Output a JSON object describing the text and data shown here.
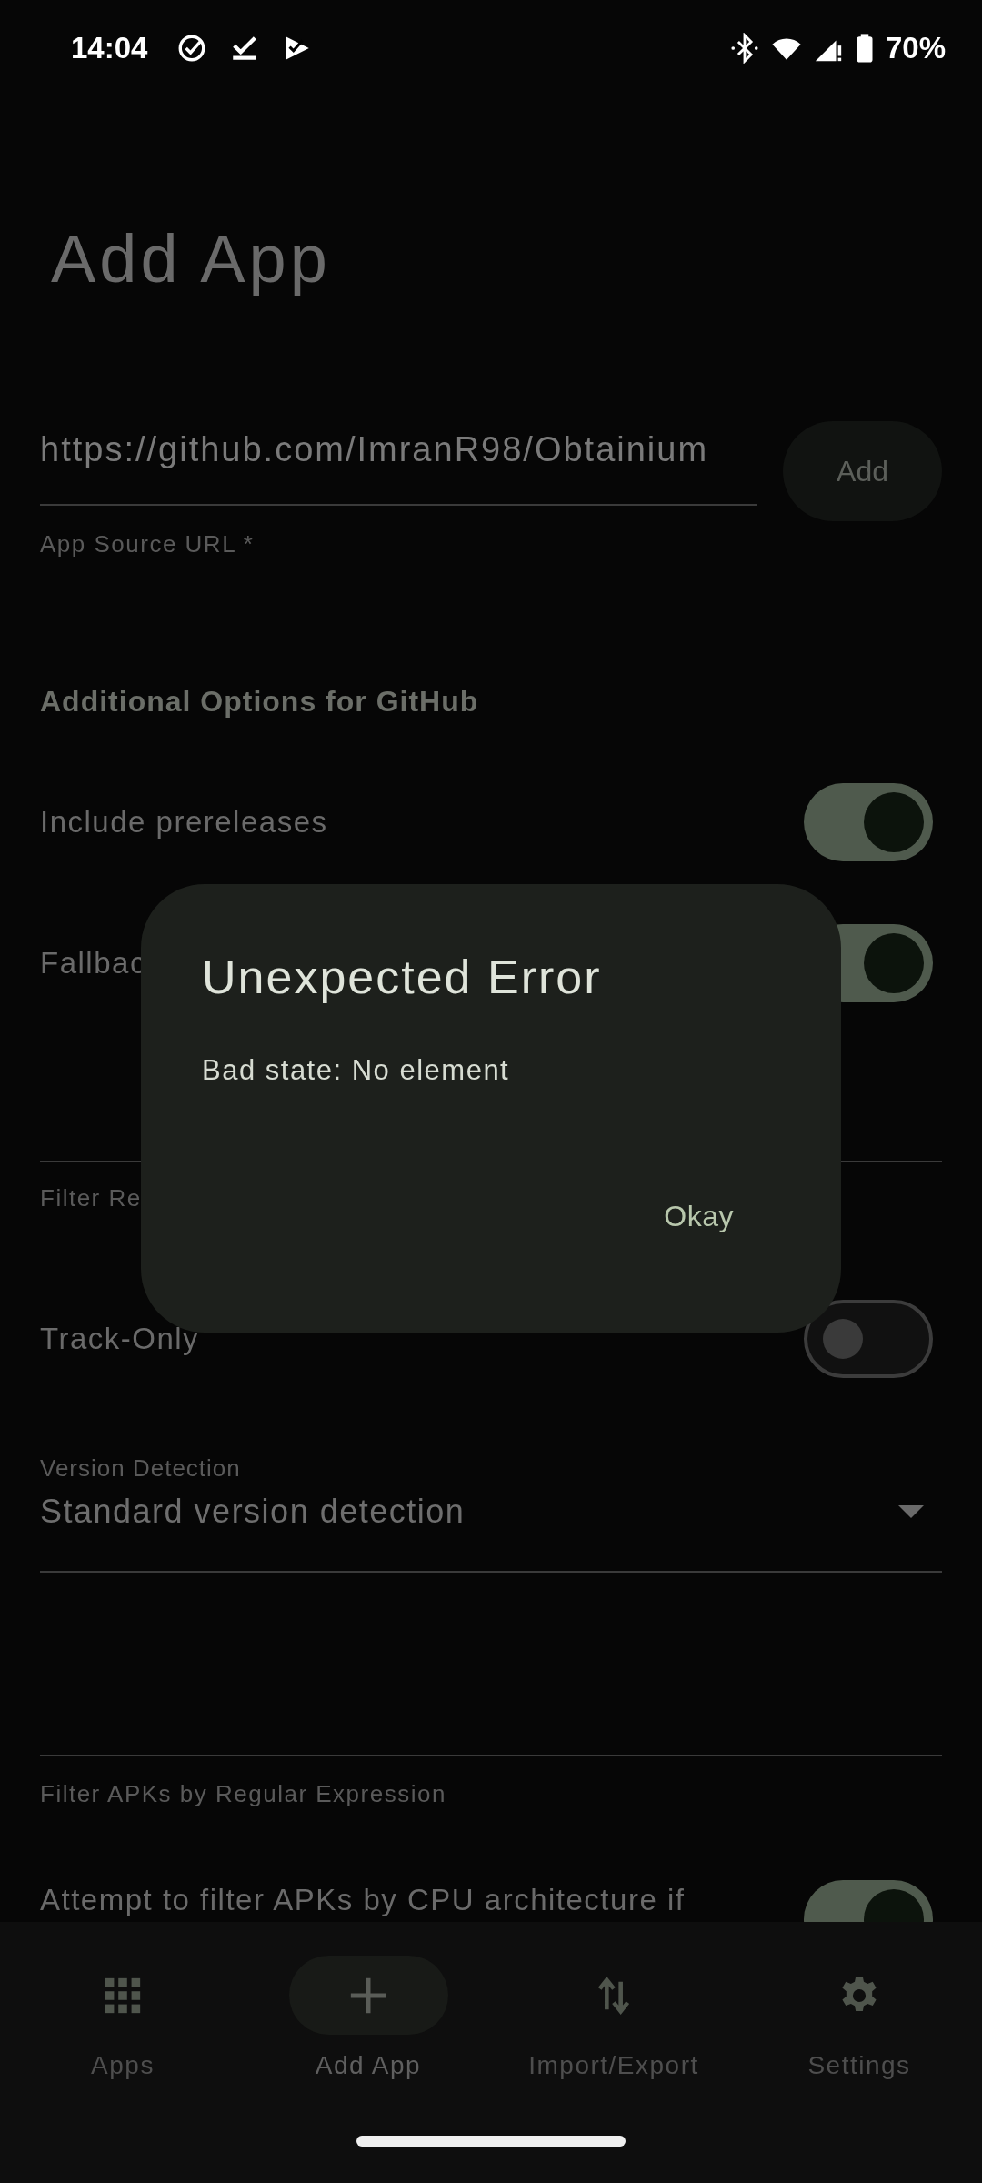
{
  "status_bar": {
    "time": "14:04",
    "battery": "70%"
  },
  "title": "Add App",
  "url_field": {
    "value": "https://github.com/ImranR98/Obtainium",
    "label": "App Source URL *"
  },
  "add_button": {
    "label": "Add"
  },
  "section_title": "Additional Options for GitHub",
  "options": [
    {
      "kind": "toggle",
      "label": "Include prereleases",
      "on": true
    },
    {
      "kind": "toggle",
      "label": "Fallbac",
      "on": true
    },
    {
      "kind": "field",
      "label": "Filter Re"
    },
    {
      "kind": "toggle",
      "label": "Track-Only",
      "on": false
    },
    {
      "kind": "dropdown",
      "label": "Version Detection",
      "value": "Standard version detection"
    },
    {
      "kind": "field",
      "label": "Filter APKs by Regular Expression"
    },
    {
      "kind": "toggle",
      "label": "Attempt to filter APKs by CPU architecture if",
      "on": true
    }
  ],
  "dialog": {
    "title": "Unexpected Error",
    "message": "Bad state: No element",
    "button": "Okay"
  },
  "nav": [
    {
      "kind": "grid",
      "label": "Apps",
      "selected": false
    },
    {
      "kind": "plus",
      "label": "Add App",
      "selected": true
    },
    {
      "kind": "arrows",
      "label": "Import/Export",
      "selected": false
    },
    {
      "kind": "gear",
      "label": "Settings",
      "selected": false
    }
  ]
}
